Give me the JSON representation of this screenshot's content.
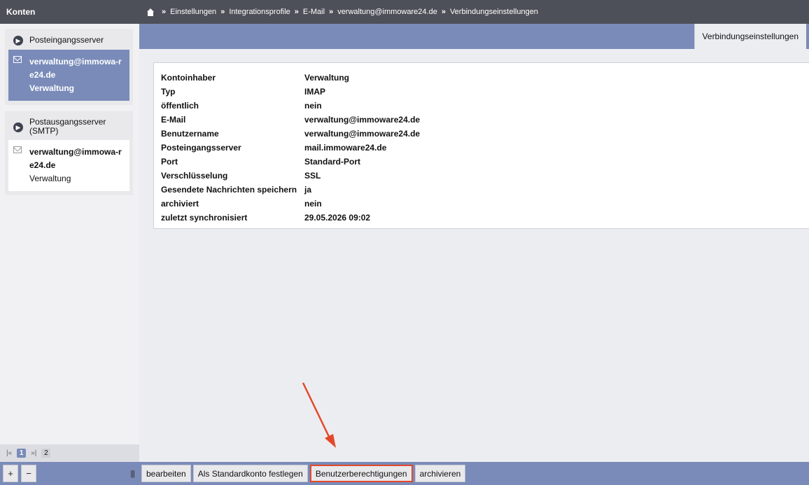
{
  "sidebar": {
    "title": "Konten",
    "groups": [
      {
        "label": "Posteingangsserver",
        "accounts": [
          {
            "address": "verwaltung@immowa-re24.de",
            "name": "Verwaltung"
          }
        ]
      },
      {
        "label": "Postausgangsserver (SMTP)",
        "accounts": [
          {
            "address": "verwaltung@immowa-re24.de",
            "name": "Verwaltung"
          }
        ]
      }
    ],
    "pager": {
      "first": "|«",
      "current": "1",
      "last": "»|",
      "other": "2"
    },
    "add_label": "+",
    "remove_label": "−",
    "grip": "|||"
  },
  "breadcrumb": {
    "sep": "»",
    "items": [
      "Einstellungen",
      "Integrationsprofile",
      "E-Mail",
      "verwaltung@immoware24.de",
      "Verbindungseinstellungen"
    ]
  },
  "tabs": [
    {
      "label": "Verbindungseinstellungen"
    }
  ],
  "details": [
    {
      "label": "Kontoinhaber",
      "value": "Verwaltung"
    },
    {
      "label": "Typ",
      "value": "IMAP"
    },
    {
      "label": "öffentlich",
      "value": "nein"
    },
    {
      "label": "E-Mail",
      "value": "verwaltung@immoware24.de"
    },
    {
      "label": "Benutzername",
      "value": "verwaltung@immoware24.de"
    },
    {
      "label": "Posteingangsserver",
      "value": "mail.immoware24.de"
    },
    {
      "label": "Port",
      "value": "Standard-Port"
    },
    {
      "label": "Verschlüsselung",
      "value": "SSL"
    },
    {
      "label": "Gesendete Nachrichten speichern",
      "value": "ja"
    },
    {
      "label": "archiviert",
      "value": "nein"
    },
    {
      "label": "zuletzt synchronisiert",
      "value": "29.05.2026 09:02"
    }
  ],
  "actions": {
    "edit": "bearbeiten",
    "set_default": "Als Standardkonto festlegen",
    "permissions": "Benutzerberechtigungen",
    "archive": "archivieren"
  },
  "colors": {
    "accent": "#7a8bb9",
    "header": "#4d5058",
    "highlight": "#e4482a"
  }
}
